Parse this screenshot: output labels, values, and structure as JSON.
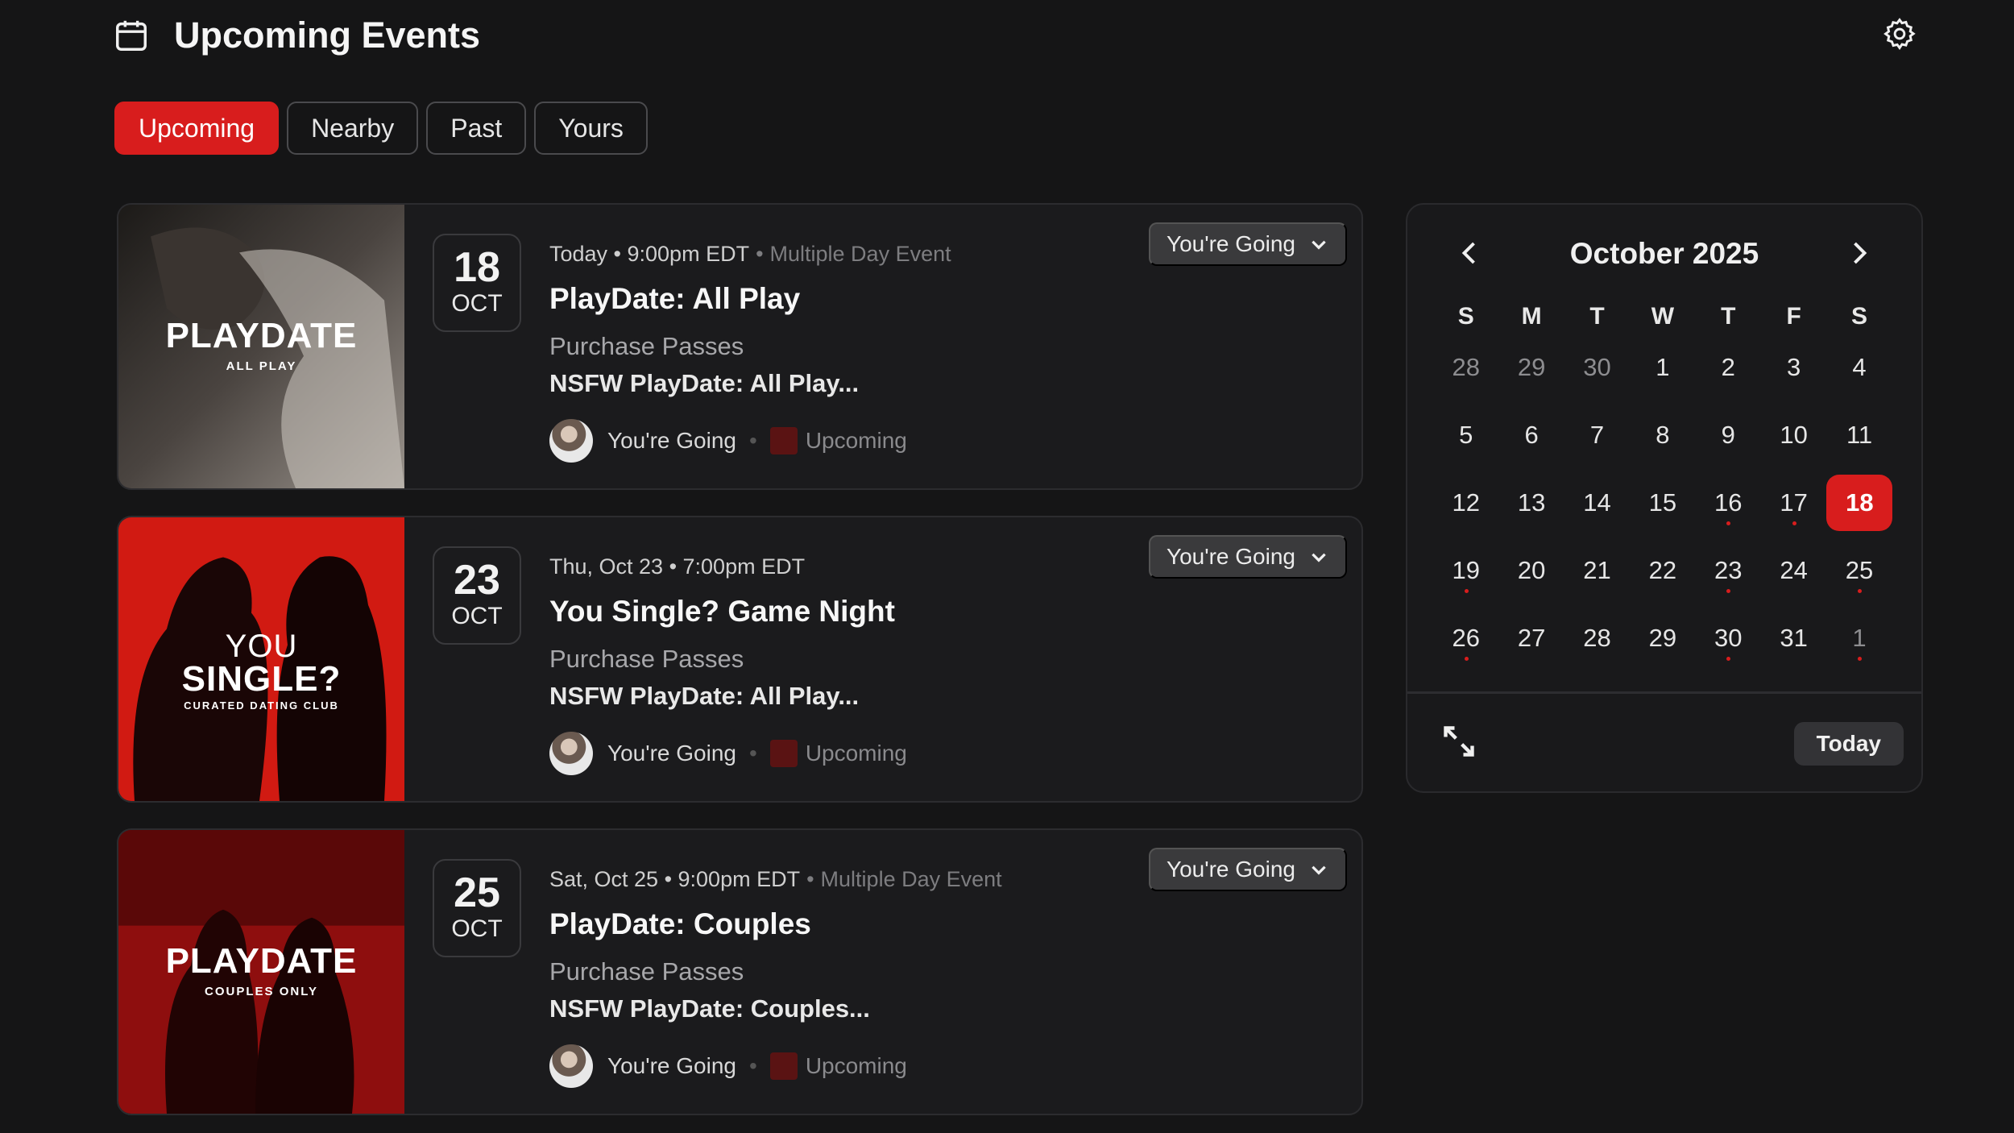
{
  "header": {
    "title": "Upcoming Events"
  },
  "tabs": [
    {
      "label": "Upcoming",
      "active": true
    },
    {
      "label": "Nearby",
      "active": false
    },
    {
      "label": "Past",
      "active": false
    },
    {
      "label": "Yours",
      "active": false
    }
  ],
  "events": [
    {
      "day": "18",
      "month": "OCT",
      "when": "Today • 9:00pm EDT",
      "multi_day": "Multiple Day Event",
      "title": "PlayDate: All Play",
      "passes": "Purchase Passes",
      "description": "NSFW PlayDate: All Play...",
      "status": "You're Going",
      "state": "Upcoming",
      "rsvp": "You're Going",
      "thumb_title": "PLAYDATE",
      "thumb_subtitle": "ALL PLAY"
    },
    {
      "day": "23",
      "month": "OCT",
      "when": "Thu, Oct 23 • 7:00pm EDT",
      "multi_day": "",
      "title": "You Single? Game Night",
      "passes": "Purchase Passes",
      "description": "NSFW PlayDate: All Play...",
      "status": "You're Going",
      "state": "Upcoming",
      "rsvp": "You're Going",
      "thumb_title_a": "YOU",
      "thumb_title": "SINGLE?",
      "thumb_subtitle": "CURATED DATING CLUB"
    },
    {
      "day": "25",
      "month": "OCT",
      "when": "Sat, Oct 25 • 9:00pm EDT",
      "multi_day": "Multiple Day Event",
      "title": "PlayDate: Couples",
      "passes": "Purchase Passes",
      "description": "NSFW PlayDate: Couples...",
      "status": "You're Going",
      "state": "Upcoming",
      "rsvp": "You're Going",
      "thumb_title": "PLAYDATE",
      "thumb_subtitle": "COUPLES ONLY"
    }
  ],
  "calendar": {
    "month_label": "October 2025",
    "weekdays": [
      "S",
      "M",
      "T",
      "W",
      "T",
      "F",
      "S"
    ],
    "days": [
      {
        "d": "28",
        "muted": true
      },
      {
        "d": "29",
        "muted": true
      },
      {
        "d": "30",
        "muted": true
      },
      {
        "d": "1"
      },
      {
        "d": "2"
      },
      {
        "d": "3"
      },
      {
        "d": "4"
      },
      {
        "d": "5"
      },
      {
        "d": "6"
      },
      {
        "d": "7"
      },
      {
        "d": "8"
      },
      {
        "d": "9"
      },
      {
        "d": "10"
      },
      {
        "d": "11"
      },
      {
        "d": "12"
      },
      {
        "d": "13"
      },
      {
        "d": "14"
      },
      {
        "d": "15"
      },
      {
        "d": "16",
        "event": true
      },
      {
        "d": "17",
        "event": true
      },
      {
        "d": "18",
        "selected": true
      },
      {
        "d": "19",
        "event": true
      },
      {
        "d": "20"
      },
      {
        "d": "21"
      },
      {
        "d": "22"
      },
      {
        "d": "23",
        "event": true
      },
      {
        "d": "24"
      },
      {
        "d": "25",
        "event": true
      },
      {
        "d": "26",
        "event": true
      },
      {
        "d": "27"
      },
      {
        "d": "28"
      },
      {
        "d": "29"
      },
      {
        "d": "30",
        "event": true
      },
      {
        "d": "31"
      },
      {
        "d": "1",
        "muted": true,
        "event": true
      }
    ],
    "today_label": "Today"
  },
  "colors": {
    "accent": "#d81d1d",
    "background": "#151516",
    "card": "#1b1b1d"
  },
  "icons": {
    "header": "calendar-icon",
    "settings": "gear-icon",
    "prev": "chevron-left-icon",
    "next": "chevron-right-icon",
    "expand": "expand-icon",
    "rsvp": "chevron-down-icon"
  }
}
